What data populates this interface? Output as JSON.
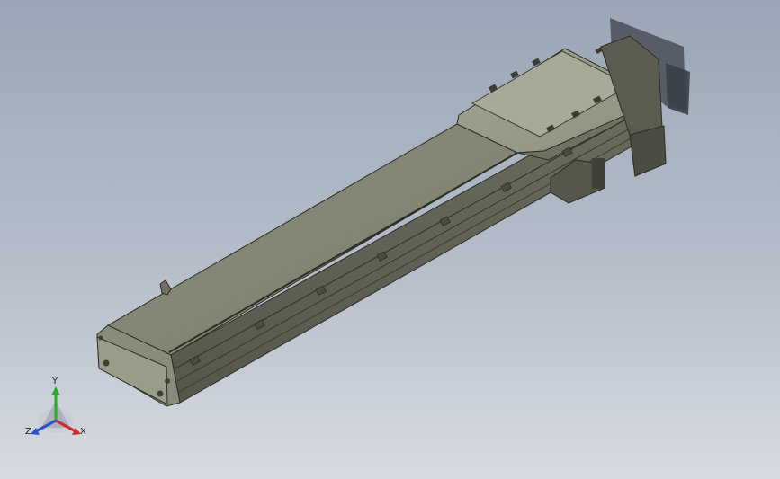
{
  "triad": {
    "y_label": "Y",
    "x_label": "X",
    "z_label": "Z"
  }
}
